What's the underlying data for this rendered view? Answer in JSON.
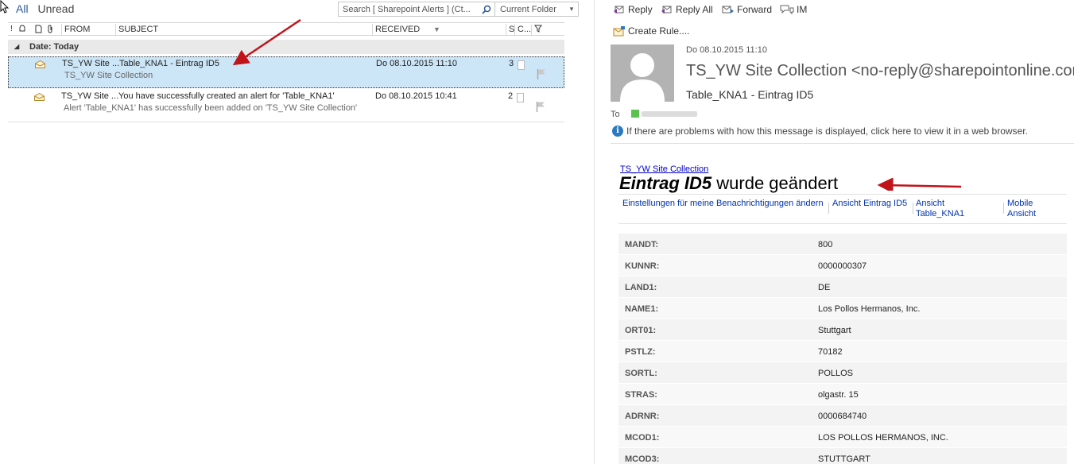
{
  "filters": {
    "all": "All",
    "unread": "Unread"
  },
  "search": {
    "placeholder": "Search [ Sharepoint Alerts ] (Ct...",
    "scope": "Current Folder"
  },
  "columns": {
    "from": "FROM",
    "subject": "SUBJECT",
    "received": "RECEIVED",
    "size": "S",
    "categories": "C..."
  },
  "group": {
    "label": "Date: Today"
  },
  "messages": [
    {
      "from": "TS_YW Site ...",
      "subject": "Table_KNA1 - Eintrag ID5",
      "preview": "TS_YW Site Collection",
      "received": "Do 08.10.2015 11:10",
      "size": "3",
      "selected": true
    },
    {
      "from": "TS_YW Site ...",
      "subject": "You have successfully created an alert for 'Table_KNA1'",
      "preview": "Alert 'Table_KNA1' has successfully been added on 'TS_YW Site Collection'",
      "received": "Do 08.10.2015 10:41",
      "size": "2",
      "selected": false
    }
  ],
  "actions": {
    "reply": "Reply",
    "reply_all": "Reply All",
    "forward": "Forward",
    "im": "IM",
    "create_rule": "Create Rule...."
  },
  "header": {
    "date": "Do 08.10.2015 11:10",
    "from": "TS_YW Site Collection <no-reply@sharepointonline.com>",
    "subject": "Table_KNA1 - Eintrag ID5",
    "to_label": "To",
    "info": "If there are problems with how this message is displayed, click here to view it in a web browser."
  },
  "body": {
    "site_link": "TS_YW Site Collection",
    "headline_bold": "Eintrag ID5",
    "headline_rest": "wurde geändert",
    "links": [
      {
        "label": "Einstellungen für meine Benachrichtigungen ändern"
      },
      {
        "label": "Ansicht Eintrag ID5"
      },
      {
        "label": "Ansicht Table_KNA1"
      },
      {
        "label": "Mobile Ansicht"
      }
    ],
    "properties": [
      {
        "key": "MANDT:",
        "value": "800"
      },
      {
        "key": "KUNNR:",
        "value": "0000000307"
      },
      {
        "key": "LAND1:",
        "value": "DE"
      },
      {
        "key": "NAME1:",
        "value": "Los Pollos Hermanos, Inc."
      },
      {
        "key": "ORT01:",
        "value": "Stuttgart"
      },
      {
        "key": "PSTLZ:",
        "value": "70182"
      },
      {
        "key": "SORTL:",
        "value": "POLLOS"
      },
      {
        "key": "STRAS:",
        "value": "olgastr. 15"
      },
      {
        "key": "ADRNR:",
        "value": "0000684740"
      },
      {
        "key": "MCOD1:",
        "value": "LOS POLLOS HERMANOS, INC."
      },
      {
        "key": "MCOD3:",
        "value": "STUTTGART"
      }
    ]
  },
  "colors": {
    "selection": "#cde6f7",
    "accent": "#2b579a",
    "link": "#0033aa",
    "annotation_arrow": "#c0141a"
  }
}
